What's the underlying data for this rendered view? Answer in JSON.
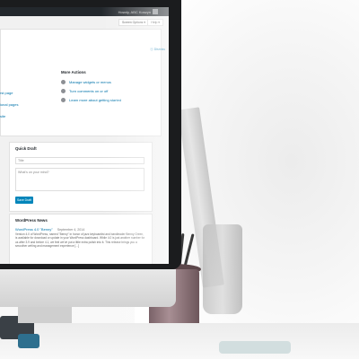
{
  "admin_bar": {
    "howdy": "Howdy, ABC Koszyn"
  },
  "top_buttons": {
    "screen_options": "Screen Options ▾",
    "help": "Help ▾"
  },
  "welcome": {
    "dismiss": "Dismiss",
    "left_links": [
      "rst page",
      "ional pages",
      "site"
    ],
    "more_actions": {
      "title": "More Actions",
      "items": [
        {
          "label": "Manage widgets or menus",
          "icon": "widgets-icon"
        },
        {
          "label": "Turn comments on or off",
          "icon": "comments-icon"
        },
        {
          "label": "Learn more about getting started",
          "icon": "learn-icon"
        }
      ]
    }
  },
  "quick_draft": {
    "title": "Quick Draft",
    "title_placeholder": "Title",
    "body_placeholder": "What's on your mind?",
    "save_label": "Save Draft"
  },
  "news": {
    "title": "WordPress News",
    "item_link": "WordPress 4.0 \"Benny\"",
    "item_date": "September 4, 2014",
    "item_text": "Version 4.0 of WordPress, named \"Benny\" in honor of jazz keyboardist and bandleader Benny Green, is available for download or update in your WordPress dashboard. While 4.0 is just another number for us after 3.9 and before 4.1, we feel we've put a little extra polish into it. This release brings you a smoother writing and management experience [...]"
  },
  "colors": {
    "admin_bar": "#23282d",
    "link": "#0073aa",
    "button": "#0085ba"
  }
}
